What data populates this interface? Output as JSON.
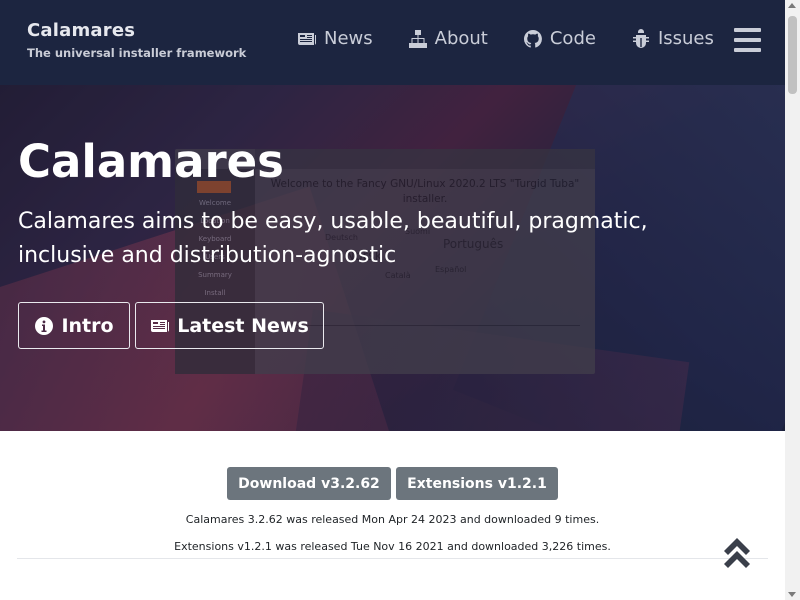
{
  "brand": {
    "title": "Calamares",
    "subtitle": "The universal installer framework"
  },
  "nav": [
    {
      "label": "News",
      "icon": "newspaper-icon"
    },
    {
      "label": "About",
      "icon": "sitemap-icon"
    },
    {
      "label": "Code",
      "icon": "github-icon"
    },
    {
      "label": "Issues",
      "icon": "bug-icon"
    }
  ],
  "hero": {
    "title": "Calamares",
    "subtitle": "Calamares aims to be easy, usable, beautiful, pragmatic, inclusive and distribution-agnostic",
    "intro_label": "Intro",
    "news_label": "Latest News",
    "screenshot": {
      "welcome": "Welcome to the Fancy GNU/Linux 2020.2 LTS \"Turgid Tuba\" installer.",
      "sidebar": [
        "Welcome",
        "Location",
        "Keyboard",
        "Users",
        "Summary",
        "Install"
      ],
      "cloud": [
        "Português",
        "Norsk",
        "Deutsch",
        "Español",
        "Català",
        "Suomi"
      ]
    }
  },
  "downloads": {
    "calamares_label": "Download v3.2.62",
    "extensions_label": "Extensions v1.2.1",
    "calamares_info": "Calamares 3.2.62 was released Mon Apr 24 2023 and downloaded 9 times.",
    "extensions_info": "Extensions v1.2.1 was released Tue Nov 16 2021 and downloaded 3,226 times."
  },
  "colors": {
    "header_bg": "#1c2540",
    "button_gray": "#6c757d",
    "accent_orange": "#d86b2f"
  }
}
